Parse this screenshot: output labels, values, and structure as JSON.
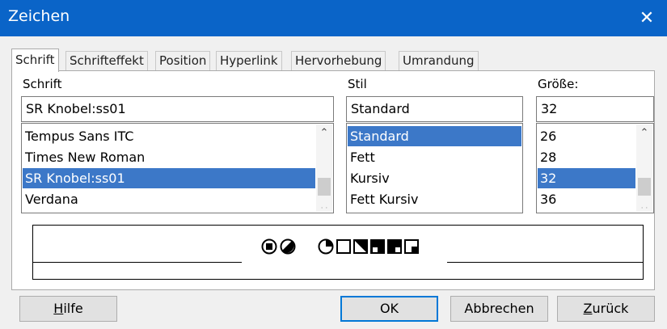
{
  "window": {
    "title": "Zeichen",
    "close_icon": "close-icon"
  },
  "tabs": [
    {
      "label": "Schrift",
      "active": true
    },
    {
      "label": "Schrifteffekt"
    },
    {
      "label": "Position"
    },
    {
      "label": "Hyperlink"
    },
    {
      "label": "Hervorhebung"
    },
    {
      "label": "Umrandung"
    }
  ],
  "font": {
    "label": "Schrift",
    "value": "SR Knobel:ss01",
    "items": [
      "Tempus Sans ITC",
      "Times New Roman",
      "SR Knobel:ss01",
      "Verdana"
    ],
    "selected_index": 2
  },
  "style": {
    "label": "Stil",
    "value": "Standard",
    "items": [
      "Standard",
      "Fett",
      "Kursiv",
      "Fett Kursiv"
    ],
    "selected_index": 0
  },
  "size": {
    "label": "Größe:",
    "value": "32",
    "items": [
      "26",
      "28",
      "32",
      "36"
    ],
    "selected_index": 2
  },
  "buttons": {
    "help_prefix": "H",
    "help_rest": "ilfe",
    "ok": "OK",
    "cancel": "Abbrechen",
    "back_prefix": "Z",
    "back_rest": "urück"
  },
  "scroll_up_icon": "chevron-up-icon"
}
